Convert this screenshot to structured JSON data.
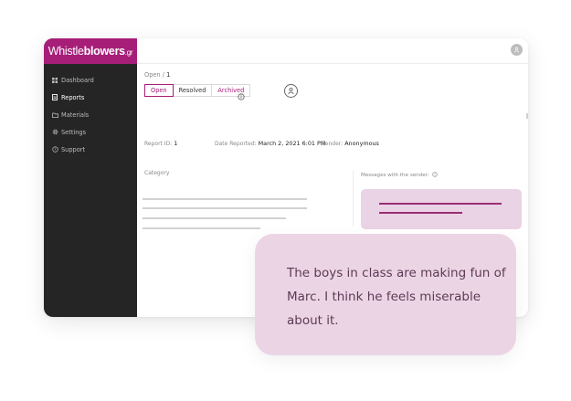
{
  "app": {
    "brand_left": "Whistle",
    "brand_right": "blowers",
    "brand_tld": ".gr",
    "accent_color": "#a61e78"
  },
  "sidebar": {
    "items": [
      {
        "label": "Dashboard",
        "icon": "grid-icon",
        "active": false
      },
      {
        "label": "Reports",
        "icon": "document-icon",
        "active": true
      },
      {
        "label": "Materials",
        "icon": "folder-icon",
        "active": false
      },
      {
        "label": "Settings",
        "icon": "gear-icon",
        "active": false
      },
      {
        "label": "Support",
        "icon": "help-icon",
        "active": false
      }
    ]
  },
  "header": {
    "avatar_icon": "user-avatar-icon"
  },
  "breadcrumb": {
    "parent": "Open",
    "separator": "/",
    "current": "1"
  },
  "tabs": [
    {
      "label": "Open",
      "selected": true
    },
    {
      "label": "Resolved",
      "selected": false
    },
    {
      "label": "Archived",
      "selected": false
    }
  ],
  "report": {
    "id_label": "Report ID:",
    "id_value": "1",
    "date_label": "Date Reported:",
    "date_value": "March 2, 2021 6:01 PM",
    "sender_label": "Sender:",
    "sender_value": "Anonymous"
  },
  "category": {
    "label": "Category"
  },
  "messages": {
    "label": "Messages with the sender:"
  },
  "quote": {
    "text": "The boys in class are making fun of Marc. I think he feels miserable about it."
  }
}
